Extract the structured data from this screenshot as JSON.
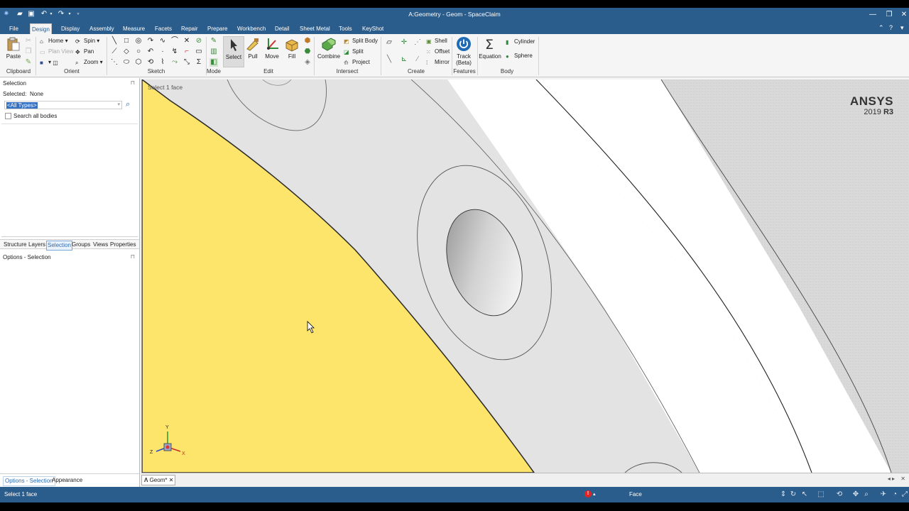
{
  "window": {
    "title": "A:Geometry - Geom - SpaceClaim"
  },
  "ribbon_tabs": [
    "File",
    "Design",
    "Display",
    "Assembly",
    "Measure",
    "Facets",
    "Repair",
    "Prepare",
    "Workbench",
    "Detail",
    "Sheet Metal",
    "Tools",
    "KeyShot"
  ],
  "ribbon": {
    "clipboard": {
      "label": "Clipboard",
      "paste": "Paste"
    },
    "orient": {
      "label": "Orient",
      "home": "Home",
      "plan_view": "Plan View",
      "spin": "Spin",
      "pan": "Pan",
      "zoom": "Zoom"
    },
    "sketch": {
      "label": "Sketch"
    },
    "mode": {
      "label": "Mode"
    },
    "edit": {
      "label": "Edit",
      "select": "Select",
      "pull": "Pull",
      "move": "Move",
      "fill": "Fill"
    },
    "intersect": {
      "label": "Intersect",
      "combine": "Combine",
      "split_body": "Split Body",
      "split": "Split",
      "project": "Project"
    },
    "create": {
      "label": "Create",
      "shell": "Shell",
      "offset": "Offset",
      "mirror": "Mirror"
    },
    "features": {
      "label": "Features",
      "track_line1": "Track",
      "track_line2": "(Beta)"
    },
    "body": {
      "label": "Body",
      "equation": "Equation",
      "cylinder": "Cylinder",
      "sphere": "Sphere"
    }
  },
  "left_panel": {
    "title": "Selection",
    "selected_label": "Selected:",
    "selected_value": "None",
    "type_filter": "<All Types>",
    "search_all_bodies": "Search all bodies",
    "tabs": [
      "Structure",
      "Layers",
      "Selection",
      "Groups",
      "Views",
      "Properties"
    ],
    "active_tab": "Selection",
    "options_title": "Options - Selection",
    "bottom_tabs": [
      "Options - Selection",
      "Appearance"
    ]
  },
  "viewport": {
    "hint": "Select 1 face",
    "brand": "ANSYS",
    "version_year": "2019",
    "version_release": "R3",
    "axis_labels": {
      "y": "Y",
      "x": "X",
      "z": "Z"
    },
    "colors": {
      "selected_face": "#fde46a",
      "surface": "#e3e3e3",
      "band": "#ffffff"
    }
  },
  "document_tab": {
    "label": "Geom*"
  },
  "status_bar": {
    "message": "Select 1 face",
    "selection_type": "Face"
  },
  "colors": {
    "chrome": "#2b5d8c",
    "accent": "#2d6bb3"
  }
}
